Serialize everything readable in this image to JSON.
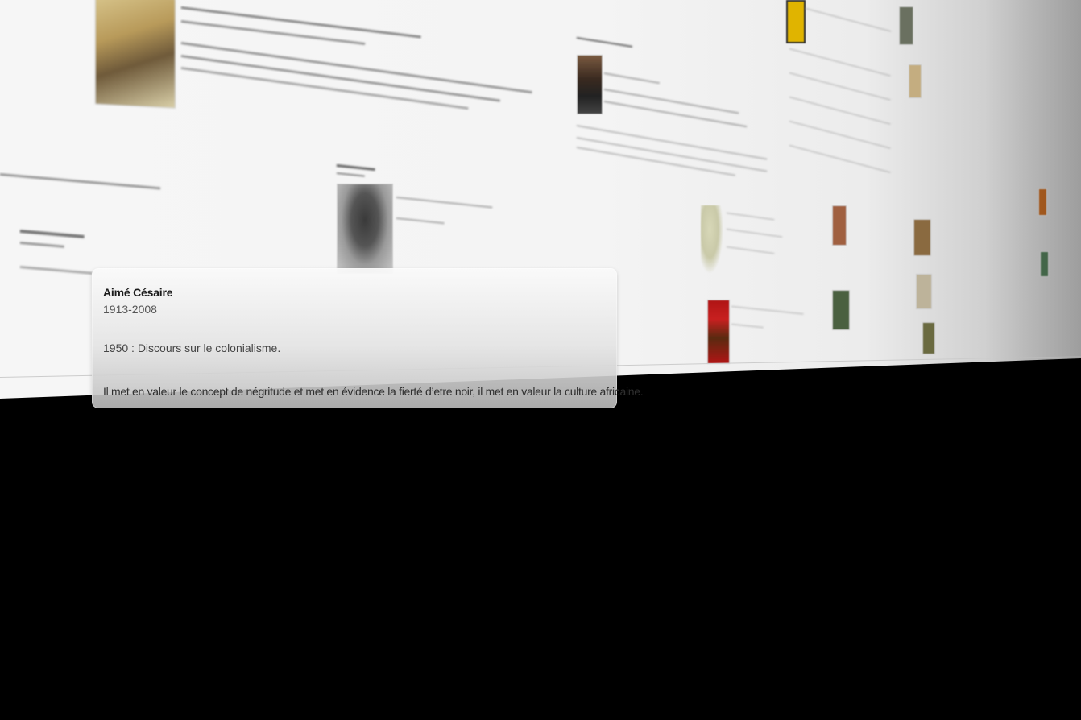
{
  "tooltip": {
    "name": "Aimé Césaire",
    "dates": "1913-2008",
    "fact": "1950 : Discours sur le colonialisme.",
    "description": "Il met en valeur le concept de négritude et met en évidence la fierté d’etre noir, il met en valeur la culture africaine."
  },
  "colors": {
    "background": "#000000",
    "timeline_surface": "#f4f4f4",
    "tooltip_text": "#1a1a1a"
  },
  "icons": [
    "portrait-photo",
    "africa-map",
    "magazine-cover",
    "poster-image"
  ]
}
